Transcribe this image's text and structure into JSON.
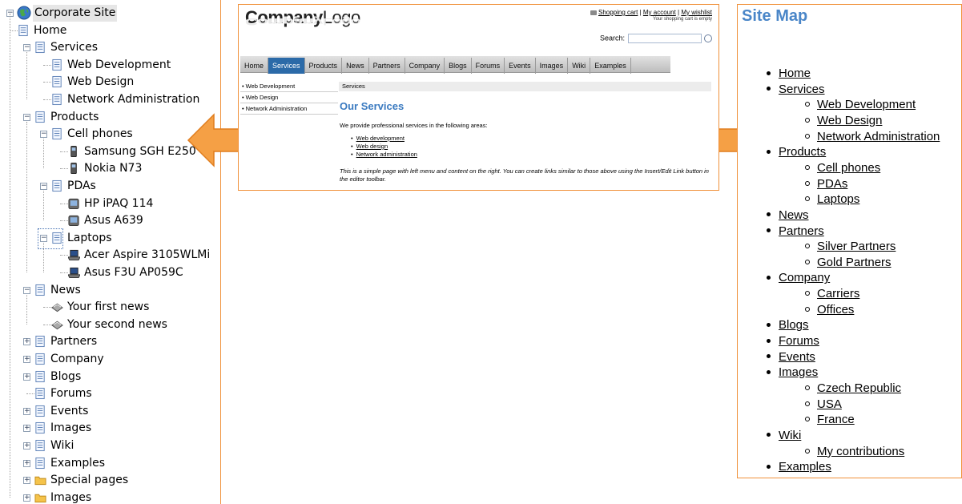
{
  "colors": {
    "panel_border": "#f0913a",
    "arrow_fill": "#f5a045",
    "nav_active": "#2b6aa8",
    "heading_blue": "#4a86c8"
  },
  "tree": {
    "root": "Corporate Site",
    "items": [
      {
        "label": "Home",
        "icon": "page-icon"
      },
      {
        "label": "Services",
        "icon": "page-icon",
        "expander": "−"
      },
      {
        "label": "Web Development",
        "icon": "page-icon"
      },
      {
        "label": "Web Design",
        "icon": "page-icon"
      },
      {
        "label": "Network Administration",
        "icon": "page-icon"
      },
      {
        "label": "Products",
        "icon": "page-icon",
        "expander": "−"
      },
      {
        "label": "Cell phones",
        "icon": "page-icon",
        "expander": "−"
      },
      {
        "label": "Samsung SGH E250",
        "icon": "phone-icon"
      },
      {
        "label": "Nokia N73",
        "icon": "phone-icon"
      },
      {
        "label": "PDAs",
        "icon": "page-icon",
        "expander": "−"
      },
      {
        "label": "HP iPAQ 114",
        "icon": "pda-icon"
      },
      {
        "label": "Asus A639",
        "icon": "pda-icon"
      },
      {
        "label": "Laptops",
        "icon": "page-icon",
        "expander": "−"
      },
      {
        "label": "Acer Aspire 3105WLMi",
        "icon": "laptop-icon"
      },
      {
        "label": "Asus F3U AP059C",
        "icon": "laptop-icon"
      },
      {
        "label": "News",
        "icon": "page-icon",
        "expander": "−"
      },
      {
        "label": "Your first news",
        "icon": "news-icon"
      },
      {
        "label": "Your second news",
        "icon": "news-icon"
      },
      {
        "label": "Partners",
        "icon": "page-icon",
        "expander": "+"
      },
      {
        "label": "Company",
        "icon": "page-icon",
        "expander": "+"
      },
      {
        "label": "Blogs",
        "icon": "page-icon",
        "expander": "+"
      },
      {
        "label": "Forums",
        "icon": "page-icon"
      },
      {
        "label": "Events",
        "icon": "page-icon",
        "expander": "+"
      },
      {
        "label": "Images",
        "icon": "page-icon",
        "expander": "+"
      },
      {
        "label": "Wiki",
        "icon": "page-icon",
        "expander": "+"
      },
      {
        "label": "Examples",
        "icon": "page-icon",
        "expander": "+"
      },
      {
        "label": "Special pages",
        "icon": "folder-icon",
        "expander": "+"
      },
      {
        "label": "Images",
        "icon": "folder-icon",
        "expander": "+"
      }
    ]
  },
  "preview": {
    "logo_bold": "Company",
    "logo_light": "Logo",
    "links": [
      "Shopping cart",
      "My account",
      "My wishlist"
    ],
    "cart_status": "Your shopping cart is empty",
    "search_label": "Search:",
    "nav": [
      "Home",
      "Services",
      "Products",
      "News",
      "Partners",
      "Company",
      "Blogs",
      "Forums",
      "Events",
      "Images",
      "Wiki",
      "Examples"
    ],
    "nav_active": "Services",
    "left_menu": [
      "Web Development",
      "Web Design",
      "Network Administration"
    ],
    "breadcrumb": "Services",
    "heading": "Our Services",
    "intro": "We provide professional services in the following areas:",
    "services": [
      "Web development",
      "Web design",
      "Network administration"
    ],
    "note": "This is a simple page with left menu and content on the right. You can create links similar to those above using the Insert/Edit Link button in the editor toolbar."
  },
  "sitemap": {
    "title": "Site Map",
    "items": [
      {
        "label": "Home"
      },
      {
        "label": "Services",
        "children": [
          "Web Development",
          "Web Design",
          "Network Administration"
        ]
      },
      {
        "label": "Products",
        "children": [
          "Cell phones",
          "PDAs",
          "Laptops"
        ]
      },
      {
        "label": "News"
      },
      {
        "label": "Partners",
        "children": [
          "Silver Partners",
          "Gold Partners"
        ]
      },
      {
        "label": "Company",
        "children": [
          "Carriers",
          "Offices"
        ]
      },
      {
        "label": "Blogs"
      },
      {
        "label": "Forums"
      },
      {
        "label": "Events"
      },
      {
        "label": "Images",
        "children": [
          "Czech Republic",
          "USA",
          "France"
        ]
      },
      {
        "label": "Wiki",
        "children": [
          "My contributions"
        ]
      },
      {
        "label": "Examples"
      }
    ]
  }
}
